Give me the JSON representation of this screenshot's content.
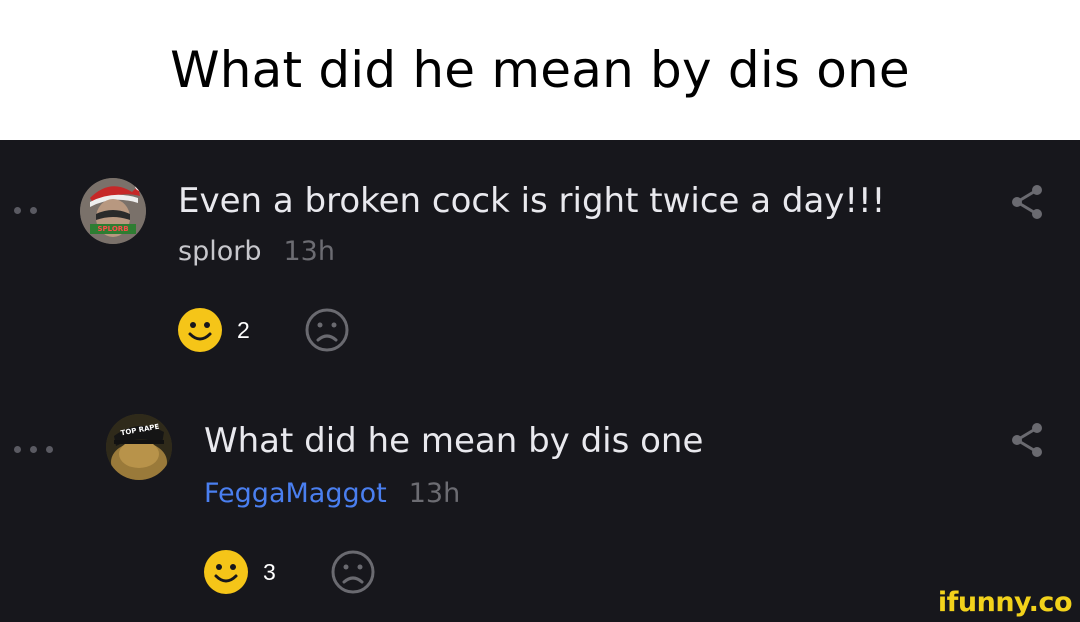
{
  "caption": "What did he mean by dis one",
  "comments": [
    {
      "text": "Even a broken cock is right twice a day!!!",
      "username": "splorb",
      "time": "13h",
      "smiles": "2",
      "avatar_badge": "SPLORB"
    },
    {
      "text": "What did he mean by dis one",
      "username": "FeggaMaggot",
      "time": "13h",
      "smiles": "3",
      "avatar_badge": "TOP RAPE"
    }
  ],
  "watermark": "ifunny.co",
  "colors": {
    "background": "#17171c",
    "username_highlight": "#4a7ff0",
    "smile": "#f5c518",
    "watermark": "#f2d21b"
  }
}
